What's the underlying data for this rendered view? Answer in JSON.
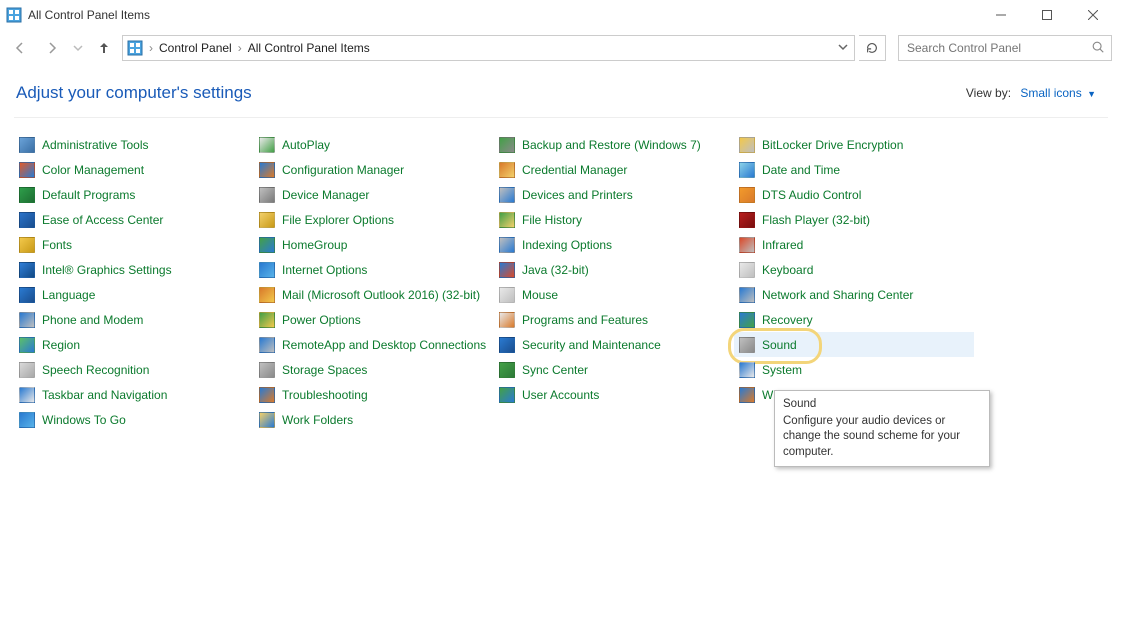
{
  "window": {
    "title": "All Control Panel Items"
  },
  "breadcrumb": {
    "root": "Control Panel",
    "current": "All Control Panel Items"
  },
  "search": {
    "placeholder": "Search Control Panel"
  },
  "heading": "Adjust your computer's settings",
  "viewby": {
    "label": "View by:",
    "value": "Small icons"
  },
  "columns": [
    [
      {
        "label": "Administrative Tools",
        "icon": "admin-tools",
        "c1": "#6aa2d8",
        "c2": "#3a6fa5"
      },
      {
        "label": "Color Management",
        "icon": "color-mgmt",
        "c1": "#e05a2b",
        "c2": "#2a7ad1"
      },
      {
        "label": "Default Programs",
        "icon": "default-programs",
        "c1": "#2e9e4a",
        "c2": "#1d6e32"
      },
      {
        "label": "Ease of Access Center",
        "icon": "ease-access",
        "c1": "#2a72c9",
        "c2": "#1a4e8f"
      },
      {
        "label": "Fonts",
        "icon": "fonts",
        "c1": "#f2c84b",
        "c2": "#c99a17"
      },
      {
        "label": "Intel® Graphics Settings",
        "icon": "intel-graphics",
        "c1": "#2f7ed8",
        "c2": "#124a85"
      },
      {
        "label": "Language",
        "icon": "language",
        "c1": "#2a7ad1",
        "c2": "#1a4e8f"
      },
      {
        "label": "Phone and Modem",
        "icon": "phone-modem",
        "c1": "#2a7ad1",
        "c2": "#bfbfbf"
      },
      {
        "label": "Region",
        "icon": "region",
        "c1": "#5bbf6a",
        "c2": "#2a7ad1"
      },
      {
        "label": "Speech Recognition",
        "icon": "speech",
        "c1": "#d9d9d9",
        "c2": "#a8a8a8"
      },
      {
        "label": "Taskbar and Navigation",
        "icon": "taskbar",
        "c1": "#2a7ad1",
        "c2": "#e8e8e8"
      },
      {
        "label": "Windows To Go",
        "icon": "windows-to-go",
        "c1": "#2a7ad1",
        "c2": "#58b2e8"
      }
    ],
    [
      {
        "label": "AutoPlay",
        "icon": "autoplay",
        "c1": "#e8e8e8",
        "c2": "#43a047"
      },
      {
        "label": "Configuration Manager",
        "icon": "config-mgr",
        "c1": "#2a7ad1",
        "c2": "#d97a2b"
      },
      {
        "label": "Device Manager",
        "icon": "device-mgr",
        "c1": "#bfbfbf",
        "c2": "#7a7a7a"
      },
      {
        "label": "File Explorer Options",
        "icon": "file-explorer",
        "c1": "#f2d06b",
        "c2": "#c99a17"
      },
      {
        "label": "HomeGroup",
        "icon": "homegroup",
        "c1": "#43a047",
        "c2": "#2a7ad1"
      },
      {
        "label": "Internet Options",
        "icon": "internet-options",
        "c1": "#2a7ad1",
        "c2": "#58b2e8"
      },
      {
        "label": "Mail (Microsoft Outlook 2016) (32-bit)",
        "icon": "mail",
        "c1": "#d97a2b",
        "c2": "#f2c84b"
      },
      {
        "label": "Power Options",
        "icon": "power",
        "c1": "#43a047",
        "c2": "#f2c84b"
      },
      {
        "label": "RemoteApp and Desktop Connections",
        "icon": "remoteapp",
        "c1": "#2a7ad1",
        "c2": "#bfbfbf"
      },
      {
        "label": "Storage Spaces",
        "icon": "storage",
        "c1": "#bfbfbf",
        "c2": "#8a8a8a"
      },
      {
        "label": "Troubleshooting",
        "icon": "troubleshoot",
        "c1": "#2a7ad1",
        "c2": "#d97a2b"
      },
      {
        "label": "Work Folders",
        "icon": "work-folders",
        "c1": "#f2d06b",
        "c2": "#2a7ad1"
      }
    ],
    [
      {
        "label": "Backup and Restore (Windows 7)",
        "icon": "backup",
        "c1": "#43a047",
        "c2": "#8a8a8a"
      },
      {
        "label": "Credential Manager",
        "icon": "credential",
        "c1": "#d97a2b",
        "c2": "#f2d06b"
      },
      {
        "label": "Devices and Printers",
        "icon": "devices-printers",
        "c1": "#bfbfbf",
        "c2": "#2a7ad1"
      },
      {
        "label": "File History",
        "icon": "file-history",
        "c1": "#43a047",
        "c2": "#f2d06b"
      },
      {
        "label": "Indexing Options",
        "icon": "indexing",
        "c1": "#bfbfbf",
        "c2": "#2a7ad1"
      },
      {
        "label": "Java (32-bit)",
        "icon": "java",
        "c1": "#2a7ad1",
        "c2": "#d94a2b"
      },
      {
        "label": "Mouse",
        "icon": "mouse",
        "c1": "#e8e8e8",
        "c2": "#bfbfbf"
      },
      {
        "label": "Programs and Features",
        "icon": "programs",
        "c1": "#e8e8e8",
        "c2": "#d97a2b"
      },
      {
        "label": "Security and Maintenance",
        "icon": "security",
        "c1": "#2a7ad1",
        "c2": "#1a4e8f"
      },
      {
        "label": "Sync Center",
        "icon": "sync",
        "c1": "#43a047",
        "c2": "#2e7a38"
      },
      {
        "label": "User Accounts",
        "icon": "users",
        "c1": "#43a047",
        "c2": "#2a7ad1"
      }
    ],
    [
      {
        "label": "BitLocker Drive Encryption",
        "icon": "bitlocker",
        "c1": "#f2c84b",
        "c2": "#bfbfbf"
      },
      {
        "label": "Date and Time",
        "icon": "date-time",
        "c1": "#8ad1e8",
        "c2": "#2a7ad1"
      },
      {
        "label": "DTS Audio Control",
        "icon": "dts-audio",
        "c1": "#f29a2b",
        "c2": "#d97a2b"
      },
      {
        "label": "Flash Player (32-bit)",
        "icon": "flash",
        "c1": "#b81d1d",
        "c2": "#7a0f0f"
      },
      {
        "label": "Infrared",
        "icon": "infrared",
        "c1": "#d94a2b",
        "c2": "#bfbfbf"
      },
      {
        "label": "Keyboard",
        "icon": "keyboard",
        "c1": "#e8e8e8",
        "c2": "#bfbfbf"
      },
      {
        "label": "Network and Sharing Center",
        "icon": "network",
        "c1": "#2a7ad1",
        "c2": "#bfbfbf"
      },
      {
        "label": "Recovery",
        "icon": "recovery",
        "c1": "#2a7ad1",
        "c2": "#43a047"
      },
      {
        "label": "Sound",
        "icon": "sound",
        "c1": "#bfbfbf",
        "c2": "#8a8a8a",
        "hover": true,
        "ring": true
      },
      {
        "label": "System",
        "icon": "system",
        "c1": "#2a7ad1",
        "c2": "#e8e8e8"
      },
      {
        "label": "Windows Defender Firewall",
        "icon": "firewall",
        "c1": "#2a7ad1",
        "c2": "#d97a2b",
        "clip": true
      }
    ]
  ],
  "tooltip": {
    "title": "Sound",
    "body": "Configure your audio devices or change the sound scheme for your computer."
  }
}
